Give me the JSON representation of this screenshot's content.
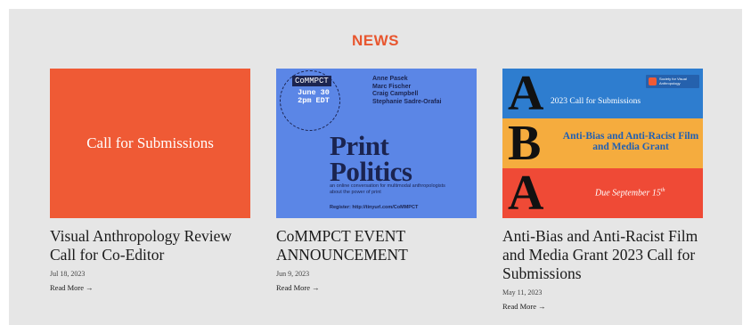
{
  "section": {
    "title": "NEWS"
  },
  "cards": [
    {
      "image": {
        "text": "Call for Submissions",
        "background": "#ef5a35"
      },
      "title": "Visual Anthropology Review Call for Co-Editor",
      "date": "Jul 18, 2023",
      "read_more": "Read More →"
    },
    {
      "image": {
        "badge_label": "CoMMPCT",
        "badge_time_line1": "June 30",
        "badge_time_line2": "2pm EDT",
        "names": [
          "Anne Pasek",
          "Marc Fischer",
          "Craig Campbell",
          "Stephanie Sadre-Orafai"
        ],
        "headline_line1": "Print",
        "headline_line2": "Politics",
        "blurb": "an online conversation for multimodal anthropologists about the power of print",
        "register": "Register: http://tinyurl.com/CoMMPCT",
        "background": "#5b86e6"
      },
      "title": "CoMMPCT EVENT ANNOUNCEMENT",
      "date": "Jun 9, 2023",
      "read_more": "Read More →"
    },
    {
      "image": {
        "letter1": "A",
        "letter2": "B",
        "letter3": "A",
        "band1_text": "2023 Call for Submissions",
        "band2_text": "Anti-Bias and Anti-Racist Film and Media Grant",
        "band3_text": "Due September 15",
        "band3_sup": "th",
        "logo_text": "Society for Visual Anthropology",
        "band_colors": [
          "#2e7dcf",
          "#f5ac3e",
          "#ef4a36"
        ]
      },
      "title": "Anti-Bias and Anti-Racist Film and Media Grant 2023 Call for Submissions",
      "date": "May 11, 2023",
      "read_more": "Read More →"
    }
  ],
  "colors": {
    "accent": "#e8562f",
    "panel": "#e6e6e6"
  }
}
